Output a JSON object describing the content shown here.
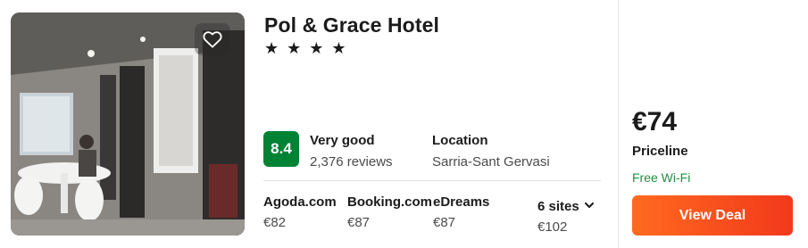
{
  "hotel": {
    "name": "Pol & Grace Hotel",
    "stars": 4,
    "stars_text": "★ ★ ★ ★",
    "photo": "hotel-lobby-photo"
  },
  "favorite": {
    "icon": "heart-outline-icon"
  },
  "rating": {
    "score": "8.4",
    "label": "Very good",
    "reviews": "2,376 reviews",
    "badge_color": "#008234"
  },
  "location": {
    "label": "Location",
    "value": "Sarria-Sant Gervasi"
  },
  "offers": [
    {
      "site": "Agoda.com",
      "price": "€82"
    },
    {
      "site": "Booking.com",
      "price": "€87"
    },
    {
      "site": "eDreams",
      "price": "€87"
    }
  ],
  "more_sites": {
    "label": "6 sites",
    "price": "€102",
    "icon": "chevron-down-icon"
  },
  "best_deal": {
    "price": "€74",
    "provider": "Priceline",
    "amenity": "Free Wi-Fi",
    "amenity_color": "#1d8f43",
    "button_label": "View Deal",
    "button_color": "#f4511e"
  }
}
